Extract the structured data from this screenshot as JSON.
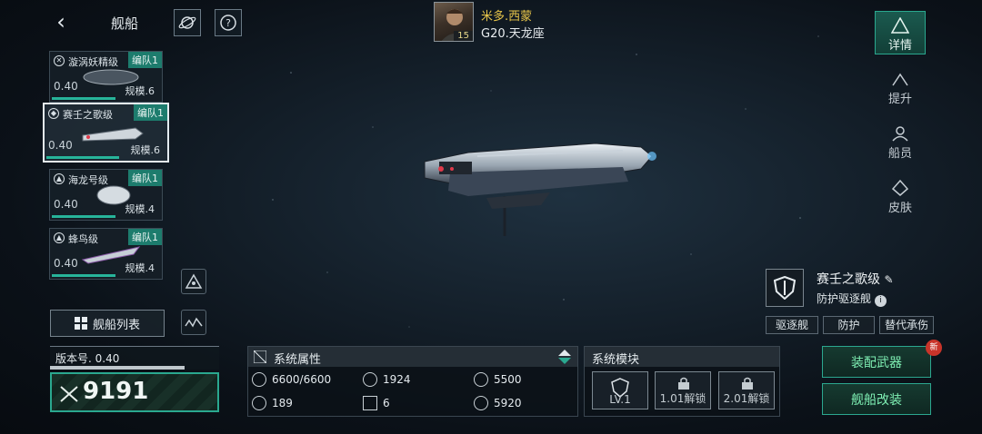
{
  "header": {
    "back_icon": "back-arrow-icon",
    "title": "舰船",
    "planet_icon": "planet-icon",
    "help_icon": "question-icon"
  },
  "commander": {
    "name": "米多.西蒙",
    "level": "15",
    "location": "G20.天龙座"
  },
  "ships": [
    {
      "name": "漩涡妖精级",
      "fleet": "编队1",
      "value": "0.40",
      "scale": "规模.6",
      "bar": 0.62,
      "icon": "vortex-icon"
    },
    {
      "name": "赛壬之歌级",
      "fleet": "编队1",
      "value": "0.40",
      "scale": "规模.6",
      "bar": 0.6,
      "icon": "shield-icon",
      "selected": true
    },
    {
      "name": "海龙号级",
      "fleet": "编队1",
      "value": "0.40",
      "scale": "规模.4",
      "bar": 0.6,
      "icon": "fighter-icon"
    },
    {
      "name": "蜂鸟级",
      "fleet": "编队1",
      "value": "0.40",
      "scale": "规模.4",
      "bar": 0.6,
      "icon": "fighter-icon"
    }
  ],
  "ship_list": {
    "label": "舰船列表"
  },
  "version": {
    "label": "版本号. 0.40",
    "progress": 0.8
  },
  "power": {
    "value": "9191"
  },
  "attributes": {
    "title": "系统属性",
    "items": [
      {
        "icon": "hp-icon",
        "value": "6600/6600"
      },
      {
        "icon": "armor-icon",
        "value": "1924"
      },
      {
        "icon": "energy-icon",
        "value": "5500"
      },
      {
        "icon": "speed-icon",
        "value": "189"
      },
      {
        "icon": "grid-icon",
        "value": "6"
      },
      {
        "icon": "target-icon",
        "value": "5920"
      }
    ]
  },
  "modules": {
    "title": "系统模块",
    "slots": [
      {
        "label": "LV.1",
        "locked": false
      },
      {
        "label": "1.01解锁",
        "locked": true
      },
      {
        "label": "2.01解锁",
        "locked": true
      }
    ]
  },
  "actions": {
    "equip": "装配武器",
    "modify": "舰船改装",
    "new_badge": "新"
  },
  "tabs": [
    {
      "label": "详情",
      "icon": "details-icon",
      "active": true
    },
    {
      "label": "提升",
      "icon": "upgrade-icon",
      "active": false
    },
    {
      "label": "船员",
      "icon": "crew-icon",
      "active": false
    },
    {
      "label": "皮肤",
      "icon": "skin-icon",
      "active": false
    }
  ],
  "ship_info": {
    "name": "赛壬之歌级",
    "role": "防护驱逐舰",
    "tags": [
      "驱逐舰",
      "防护",
      "替代承伤"
    ]
  }
}
